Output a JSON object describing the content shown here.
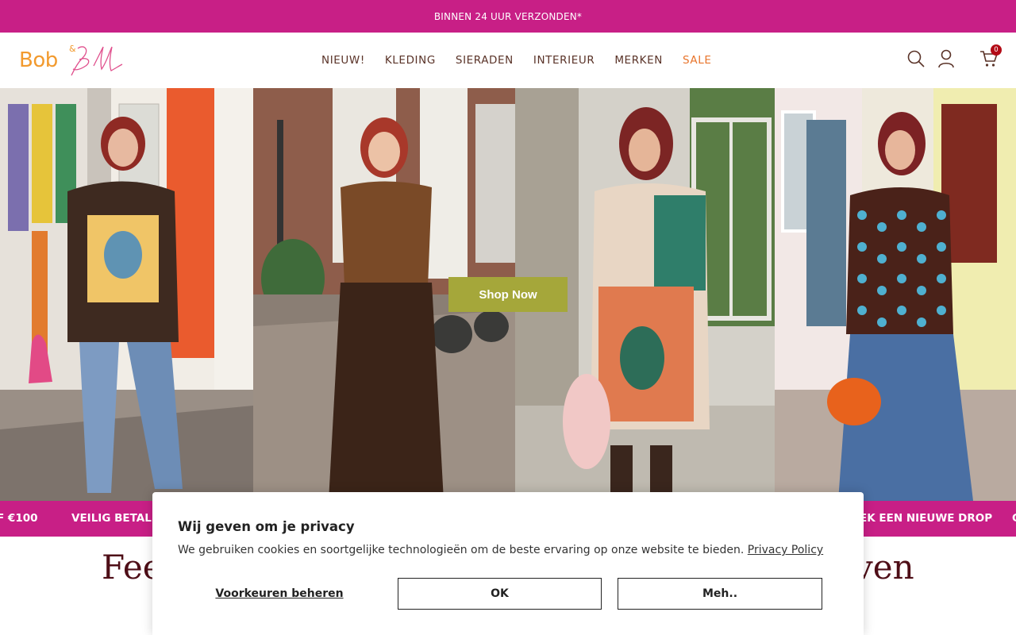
{
  "announcement": {
    "text": "BINNEN 24 UUR VERZONDEN*"
  },
  "header": {
    "logo_text": "Bob",
    "logo_amp": "&",
    "nav": [
      {
        "label": "NIEUW!"
      },
      {
        "label": "KLEDING"
      },
      {
        "label": "SIERADEN"
      },
      {
        "label": "INTERIEUR"
      },
      {
        "label": "MERKEN"
      },
      {
        "label": "SALE"
      }
    ],
    "icons": [
      "search-icon",
      "account-icon",
      "cart-icon"
    ],
    "cart_count": "0"
  },
  "hero": {
    "cta_label": "Shop Now",
    "panels": [
      "hero-photo-1",
      "hero-photo-2",
      "hero-photo-3",
      "hero-photo-4"
    ]
  },
  "marquee": {
    "items": [
      {
        "text": "F €100"
      },
      {
        "text": "VEILIG BETALEN"
      },
      {
        "text": "EK EEN NIEUWE DROP"
      },
      {
        "text": "C"
      }
    ]
  },
  "headline": {
    "left": "Fee",
    "right": "ven"
  },
  "cookie": {
    "title": "Wij geven om je privacy",
    "text": "We gebruiken cookies en soortgelijke technologieën om de beste ervaring op onze website te bieden.",
    "link": "Privacy Policy",
    "preferences": "Voorkeuren beheren",
    "ok": "OK",
    "meh": "Meh.."
  },
  "colors": {
    "brand_pink": "#c81f86",
    "logo_orange": "#f29a2e",
    "nav_text": "#5a3328",
    "sale": "#e8742b",
    "cta_olive": "#a5a73a",
    "headline": "#4e0e17",
    "badge": "#b30b16"
  }
}
